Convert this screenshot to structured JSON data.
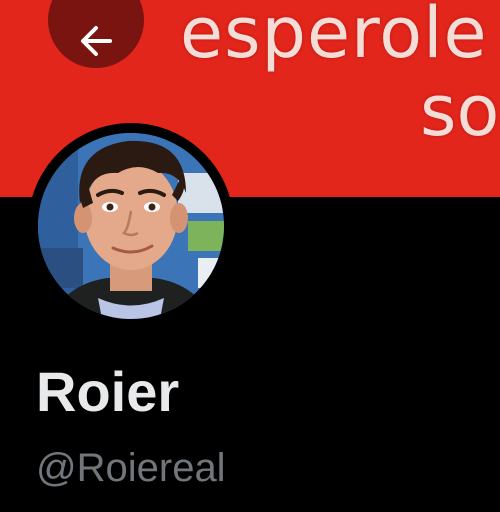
{
  "banner": {
    "text_line1": "esperole",
    "text_line2": "so",
    "color": "#e2261c"
  },
  "back_button": {
    "icon": "arrow-left-icon"
  },
  "profile": {
    "display_name": "Roier",
    "handle": "@Roiereal",
    "avatar_icon": "avatar"
  },
  "colors": {
    "background": "#000000",
    "name_text": "#e7e9ea",
    "handle_text": "#71767b"
  }
}
